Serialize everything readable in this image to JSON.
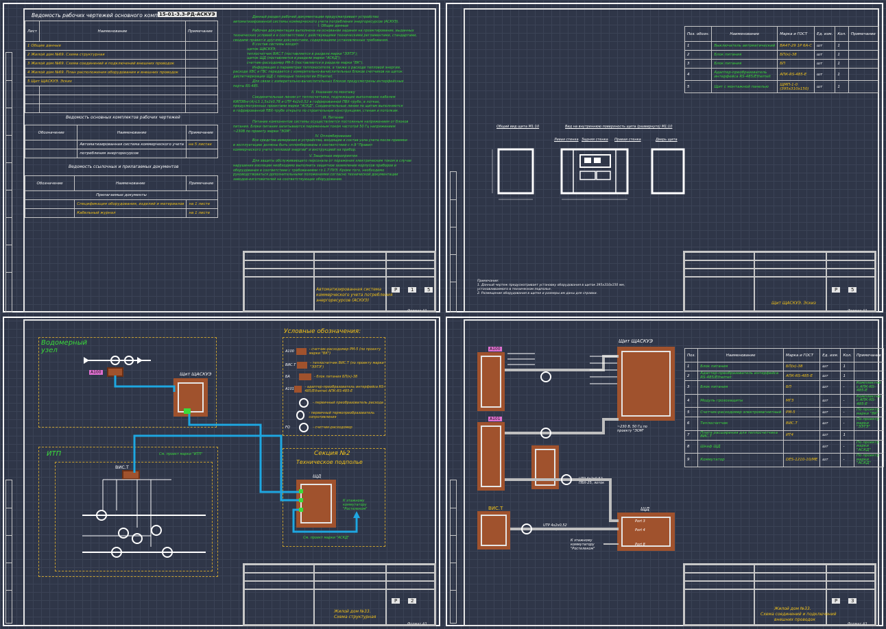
{
  "sheet1": {
    "title": "Ведомость рабочих чертежей основного комплекта",
    "code": "15-01-3.3-РД-АСКУЭ",
    "cols": {
      "sheet": "Лист",
      "name": "Наименование",
      "note": "Примечание"
    },
    "rows": [
      "1 Общие данные",
      "2 Жилой дом №69. Схема структурная",
      "3 Жилой дом №69. Схема соединений и подключений внешних проводок",
      "4 Жилой дом №69. План расположения оборудования и внешних проводок",
      "5 Щит ЩАСКУЭ. Эскиз"
    ],
    "section2": "Ведомость основных комплектов рабочих чертежей",
    "cols2": {
      "code": "Обозначение",
      "name": "Наименование",
      "note": "Примечание"
    },
    "row2a": "Автоматизированная система коммерческого учета",
    "row2b": "потребления энергоресурсов",
    "row2note": "на 5 листах",
    "section3": "Ведомость ссылочных и прилагаемых документов",
    "sub3": "Прилагаемые документы",
    "row3a": "Спецификация оборудования, изделий и материалов",
    "row3b": "Кабельный журнал",
    "row3note": "на 1 листе",
    "notes": [
      "Данный раздел рабочей документации предусматривает устройство",
      "автоматизированной системы коммерческого учета потребления энергоресурсов (АСКУЭ).",
      "I. Общие данные",
      "Рабочая документация выполнена на основании задания на проектирование, выданных",
      "технических условий и в соответствии с действующими техническими регламентами, стандартами,",
      "сводами правил и другими документами, содержащими установленные требования.",
      "В состав системы входят:",
      "щиток ЩАСКУЭ;",
      "теплосчетчик ВИС.Т (поставляется в разделе марки \"ЭЭТЭ\");",
      "щиток ЩД (поставляется в разделе марки \"АСКД\");",
      "счетчик-расходомер РМ-5 (поставляется в разделе марки \"ВК\").",
      "Информация о параметрах теплоносителя, а также о расходе тепловой энергии,",
      "расходе ХВС и ГВС передается с измерительно-вычислительных блоков счетчиков на щиток",
      "диспетчеризации ЩД с помощью технологии Ethernet.",
      "Для связи с измерительно-вычислительных блоков предусмотрены интерфейсные",
      "порты RS-485.",
      "II. Указания по монтажу",
      "Соединительные линии от теплосчетчика, подлежащие выполнению кабелем",
      "КИПЭВнг(А)-LS 1,5x2x0,78 и UTP 4x2x0,52 в гофрированной ПВХ-трубе, в лотках,",
      "предусмотренных проектами марки \"АСКД\". Соединительные линии по щитам выполняются",
      "в гофрированной ПВХ-трубе открыто по строительным конструкциям, стенам и потолкам.",
      "III. Питание",
      "Питание компонентов системы осуществляется постоянным напряжением от блоков",
      "питания. Блоки питания запитываются переменным током частотой 50 Гц напряжением",
      "~230В по проекту марки \"ЭОМ\".",
      "IV. Опломбирование",
      "Все средства измерения и устройства, входящие в состав узла учета после приемки",
      "в эксплуатацию должны быть опломбированы в соответствии с п.9 \"Правил",
      "коммерческого учета тепловой энергии\" и инструкцией на прибор.",
      "V. Защитные мероприятия",
      "Для защиты обслуживающего персонала от поражения электрическим током в случае",
      "нарушения изоляции необходимо выполнить защитное заземление корпусов приборов и",
      "оборудования в соответствии с требованиями гл.1.7 ПУЭ. Кроме того, необходимо",
      "руководствоваться дополнительными положениями согласно технической документации",
      "заводов-изготовителей на соответствующее оборудование."
    ],
    "stamp_title": [
      "Автоматизированная система",
      "коммерческого учета потребления",
      "энергоресурсов (АСКУЭ)"
    ],
    "stage": "Р",
    "sheet_no": "1",
    "sheets": "5",
    "format": "Формат А3"
  },
  "sheet2": {
    "cols": {
      "pos": "Поз. обозн.",
      "name": "Наименование",
      "mark": "Марка и ГОСТ",
      "unit": "Ед. изм.",
      "qty": "Кол.",
      "note": "Примечание"
    },
    "rows": [
      {
        "pos": "1",
        "name": "Выключатель автоматический",
        "mark": "ВА47-29 1P 6A-C",
        "unit": "шт",
        "qty": "1",
        "note": ""
      },
      {
        "pos": "2",
        "name": "Блок питания",
        "mark": "БП(к)-38",
        "unit": "шт",
        "qty": "1",
        "note": ""
      },
      {
        "pos": "3",
        "name": "Блок питания",
        "mark": "БП",
        "unit": "шт",
        "qty": "1",
        "note": ""
      },
      {
        "pos": "4",
        "name": "Адаптер-преобразователь интерфейса RS-485/Ethernet",
        "mark": "АПК-RS-485-E",
        "unit": "шт",
        "qty": "1",
        "note": ""
      },
      {
        "pos": "5",
        "name": "Щит с монтажной панелью",
        "mark": "ЩМП-1-0 (395x310x150)",
        "unit": "шт",
        "qty": "1",
        "note": ""
      }
    ],
    "view_front": "Общий вид щита М1:10",
    "view_inner": "Вид на внутреннюю поверхность щита (развернуто) М1:10",
    "walls": [
      "Левая стенка",
      "Задняя стенка",
      "Правая стенка",
      "Дверь щита"
    ],
    "notes": [
      "Примечание:",
      "1. Данный чертеж предусматривает установку оборудования в щиток 395x310x150 мм,",
      "устанавливаемого в техническом подполье.",
      "2. Размещение оборудования в щитке и размеры им даны для справки."
    ],
    "stamp_title": "Щит ЩАСКУЭ. Эскиз",
    "stage": "Р",
    "sheet_no": "5",
    "sheets": "",
    "format": "Формат А3"
  },
  "sheet3": {
    "water_node": "Водомерный узел",
    "a100": "А100",
    "shield": "Щит ЩАСКУЭ",
    "itp": "ИТП",
    "vis": "ВИС.Т",
    "section": "Секция №2",
    "section_sub": "Техническое подполье",
    "shd": "ЩД",
    "to_switch": "К этажному коммутатору \"Ростелеком\"",
    "legend_title": "Условные обозначения:",
    "legend": [
      {
        "sym": "А100",
        "text": "- счетчик-расходомер РМ-5 (по проекту марки \"ВК\")"
      },
      {
        "sym": "ВИС.Т",
        "text": "- теплосчетчик ВИС.Т (по проекту марки \"ЭЭТЭ\")"
      },
      {
        "sym": "БА",
        "text": "- блок питания БП(к)-38"
      },
      {
        "sym": "А101",
        "text": "- адаптер-преобразователь интерфейса RS-485/Ethernet АПК-RS-485-E"
      },
      {
        "sym": "",
        "text": "- первичный преобразователь расхода"
      },
      {
        "sym": "",
        "text": "- первичный термопреобразователь сопротивления"
      },
      {
        "sym": "FQ",
        "text": "- счетчик-расходомер"
      }
    ],
    "label_vis": "См. проект марки \"ИТП\"",
    "label_shd": "См. проект марки \"АСКД\"",
    "stamp_title": [
      "Жилой дом №33.",
      "Схема структурная"
    ],
    "stage": "Р",
    "sheet_no": "2",
    "sheets": "",
    "format": "Формат А3"
  },
  "sheet4": {
    "a100": "А100",
    "a101": "А101",
    "shield": "Щит ЩАСКУЭ",
    "vis": "ВИС.Т",
    "shd": "ЩД",
    "cable1": "UTP 4x2x0,52 ПВХ-25, лоток",
    "cable2": "UTP 4x2x0,52 ПВХ-25, лоток",
    "power": "~230 В, 50 Гц по проекту \"ЭОМ\"",
    "to_switch": "К этажному коммутатору \"Ростелеком\"",
    "ports": [
      "Port 3",
      "Port 4",
      "Port 8"
    ],
    "cols": {
      "pos": "Поз.",
      "name": "Наименование",
      "mark": "Марка и ГОСТ",
      "unit": "Ед. изм.",
      "qty": "Кол.",
      "note": "Примечание"
    },
    "rows": [
      {
        "pos": "1",
        "name": "Блок питания",
        "mark": "БП(к)-38",
        "unit": "шт",
        "qty": "1",
        "note": ""
      },
      {
        "pos": "2",
        "name": "Адаптер-преобразователь интерфейса RS-485/Ethernet",
        "mark": "АПК-RS-485-E",
        "unit": "шт",
        "qty": "1",
        "note": ""
      },
      {
        "pos": "3",
        "name": "Блок питания",
        "mark": "БП",
        "unit": "шт",
        "qty": "-",
        "note": "Комплектно с АПК-RS-485-E"
      },
      {
        "pos": "4",
        "name": "Модуль грозозащиты",
        "mark": "МГЗ",
        "unit": "шт",
        "qty": "-",
        "note": "Комплектно с АПК-RS-485-E"
      },
      {
        "pos": "5",
        "name": "Счетчик-расходомер электромагнитный",
        "mark": "РМ-5",
        "unit": "шт",
        "qty": "-",
        "note": "По проекту марки \"ВК\""
      },
      {
        "pos": "6",
        "name": "Теплосчетчик",
        "mark": "ВИС.Т",
        "unit": "шт",
        "qty": "-",
        "note": "По проекту марки \"ЭЭТЭ\""
      },
      {
        "pos": "7",
        "name": "Плата расширения для теплосчетчика ВИС.Т",
        "mark": "ИТ4",
        "unit": "шт",
        "qty": "1",
        "note": ""
      },
      {
        "pos": "8",
        "name": "Шкаф ЩД",
        "mark": "",
        "unit": "шт",
        "qty": "-",
        "note": "По проекту марки \"АСКД\""
      },
      {
        "pos": "9",
        "name": "Коммутатор",
        "mark": "DES-1210-10/ME",
        "unit": "шт",
        "qty": "-",
        "note": "По проекту марки \"АСКД\""
      }
    ],
    "stamp_title": [
      "Жилой дом №33.",
      "Схема соединений и подключений",
      "внешних проводок"
    ],
    "stage": "Р",
    "sheet_no": "3",
    "sheets": "",
    "format": "Формат А3"
  }
}
